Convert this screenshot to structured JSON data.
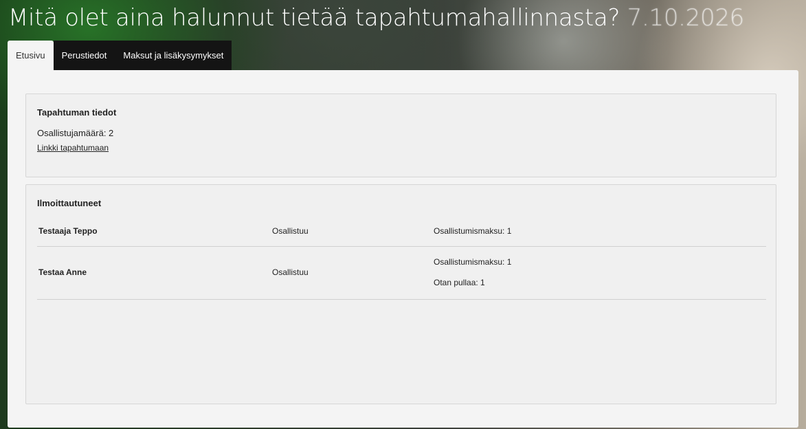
{
  "header": {
    "title": "Mitä olet aina halunnut tietää tapahtumahallinnasta?",
    "date": "7.10.2026"
  },
  "tabs": [
    {
      "label": "Etusivu",
      "active": true
    },
    {
      "label": "Perustiedot",
      "active": false
    },
    {
      "label": "Maksut ja lisäkysymykset",
      "active": false
    }
  ],
  "event_info": {
    "title": "Tapahtuman tiedot",
    "participant_count": "Osallistujamäärä: 2",
    "link_label": "Linkki tapahtumaan"
  },
  "registrants": {
    "title": "Ilmoittautuneet",
    "rows": [
      {
        "name": "Testaaja Teppo",
        "status": "Osallistuu",
        "details": [
          "Osallistumismaksu: 1"
        ]
      },
      {
        "name": "Testaa Anne",
        "status": "Osallistuu",
        "details": [
          "Osallistumismaksu: 1",
          "Otan pullaa: 1"
        ]
      }
    ]
  }
}
